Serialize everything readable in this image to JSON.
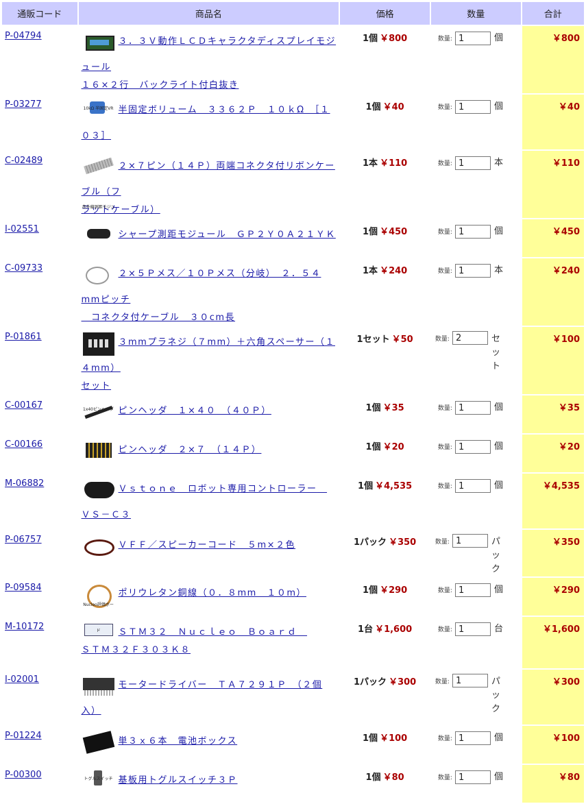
{
  "header": {
    "code": "通販コード",
    "name": "商品名",
    "price": "価格",
    "qty": "数量",
    "total": "合計"
  },
  "qty_label": "数量:",
  "rows": [
    {
      "code": "P-04794",
      "name1": "３．３Ｖ動作ＬＣＤキャラクタディスプレイモジュール",
      "name2": "１６×２行　バックライト付白抜き",
      "price_unit": "1個",
      "price": "￥800",
      "qty": "1",
      "unit": "個",
      "total": "￥800",
      "img": "lcd-image"
    },
    {
      "code": "P-03277",
      "name1": "半固定ボリューム　３３６２Ｐ　１０ｋΩ　［１０３］",
      "name2": "",
      "price_unit": "1個",
      "price": "￥40",
      "qty": "1",
      "unit": "個",
      "total": "￥40",
      "img": "trimmer-image",
      "img_text": "10kΩ 半固定VR"
    },
    {
      "code": "C-02489",
      "name1": "２×７ピン（１４Ｐ）両端コネクタ付リボンケーブル（フ",
      "name2": "ラットケーブル）",
      "price_unit": "1本",
      "price": "￥110",
      "qty": "1",
      "unit": "本",
      "total": "￥110",
      "img": "ribbon-cable-image"
    },
    {
      "code": "I-02551",
      "name1": "シャープ測距モジュール　ＧＰ２Ｙ０Ａ２１ＹＫ",
      "name2": "",
      "price_unit": "1個",
      "price": "￥450",
      "qty": "1",
      "unit": "個",
      "total": "￥450",
      "img": "sensor-image",
      "img_text": "赤外線測距モジュール"
    },
    {
      "code": "C-09733",
      "name1": "２×５Ｐメス／１０Ｐメス（分岐）　２．５４mmピッチ",
      "name2": "　コネクタ付ケーブル　３０cm長",
      "price_unit": "1本",
      "price": "￥240",
      "qty": "1",
      "unit": "本",
      "total": "￥240",
      "img": "cable-image"
    },
    {
      "code": "P-01861",
      "name1": "３mmプラネジ（７mm）＋六角スペーサー（１４mm）",
      "name2": "セット",
      "price_unit": "1セット",
      "price": "￥50",
      "qty": "2",
      "unit": "セット",
      "total": "￥100",
      "img": "screws-image"
    },
    {
      "code": "C-00167",
      "name1": "ピンヘッダ　１×４０　（４０Ｐ）",
      "name2": "",
      "price_unit": "1個",
      "price": "￥35",
      "qty": "1",
      "unit": "個",
      "total": "￥35",
      "img": "pin-header-image",
      "img_text": "1x40ピンヘッダ"
    },
    {
      "code": "C-00166",
      "name1": "ピンヘッダ　２×７　（１４Ｐ）",
      "name2": "",
      "price_unit": "1個",
      "price": "￥20",
      "qty": "1",
      "unit": "個",
      "total": "￥20",
      "img": "pin-header-2x7-image"
    },
    {
      "code": "M-06882",
      "name1": "Ｖｓｔｏｎｅ　ロボット専用コントローラー　ＶＳ－Ｃ３",
      "name2": "",
      "price_unit": "1個",
      "price": "￥4,535",
      "qty": "1",
      "unit": "個",
      "total": "￥4,535",
      "img": "controller-image"
    },
    {
      "code": "P-06757",
      "name1": "ＶＦＦ／スピーカーコード　５m×２色",
      "name2": "",
      "price_unit": "1パック",
      "price": "￥350",
      "qty": "1",
      "unit": "パック",
      "total": "￥350",
      "img": "speaker-cord-image"
    },
    {
      "code": "P-09584",
      "name1": "ポリウレタン銅線（０．８mm　１０m）",
      "name2": "",
      "price_unit": "1個",
      "price": "￥290",
      "qty": "1",
      "unit": "個",
      "total": "￥290",
      "img": "copper-wire-image"
    },
    {
      "code": "M-10172",
      "name1": "ＳＴＭ３２　Ｎｕｃｌｅｏ　Ｂｏａｒｄ　",
      "name2": "ＳＴＭ３２Ｆ３０３Ｋ８",
      "price_unit": "1台",
      "price": "￥1,600",
      "qty": "1",
      "unit": "台",
      "total": "￥1,600",
      "img": "nucleo-board-image",
      "img_text": "Nucleo評価ボード"
    },
    {
      "code": "I-02001",
      "name1": "モータードライバー　ＴＡ７２９１Ｐ　（２個入）",
      "name2": "",
      "price_unit": "1パック",
      "price": "￥300",
      "qty": "1",
      "unit": "パック",
      "total": "￥300",
      "img": "motor-driver-image"
    },
    {
      "code": "P-01224",
      "name1": "単３ｘ６本　電池ボックス",
      "name2": "",
      "price_unit": "1個",
      "price": "￥100",
      "qty": "1",
      "unit": "個",
      "total": "￥100",
      "img": "battery-box-image"
    },
    {
      "code": "P-00300",
      "name1": "基板用トグルスイッチ３Ｐ",
      "name2": "",
      "price_unit": "1個",
      "price": "￥80",
      "qty": "1",
      "unit": "個",
      "total": "￥80",
      "img": "toggle-switch-image",
      "img_text": "トグルスイッチ"
    }
  ]
}
